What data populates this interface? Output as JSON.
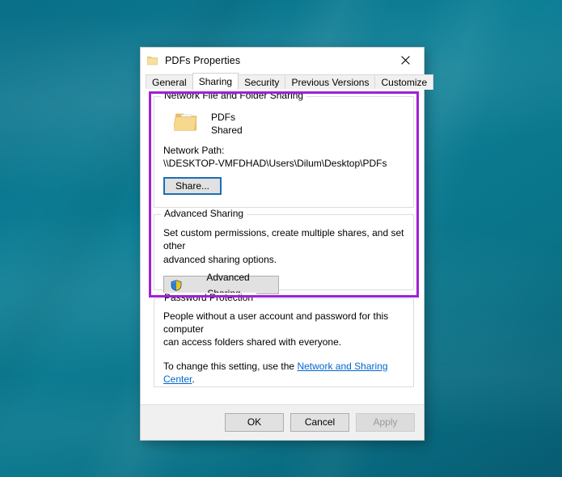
{
  "window": {
    "title": "PDFs Properties",
    "icon": "folder-icon",
    "close_label": "✕"
  },
  "tabs": [
    {
      "label": "General",
      "active": false
    },
    {
      "label": "Sharing",
      "active": true
    },
    {
      "label": "Security",
      "active": false
    },
    {
      "label": "Previous Versions",
      "active": false
    },
    {
      "label": "Customize",
      "active": false
    }
  ],
  "network_sharing": {
    "legend": "Network File and Folder Sharing",
    "folder_name": "PDFs",
    "share_status": "Shared",
    "network_path_label": "Network Path:",
    "network_path_value": "\\\\DESKTOP-VMFDHAD\\Users\\Dilum\\Desktop\\PDFs",
    "share_button": "Share..."
  },
  "advanced_sharing": {
    "legend": "Advanced Sharing",
    "description_line1": "Set custom permissions, create multiple shares, and set other",
    "description_line2": "advanced sharing options.",
    "button_label": "Advanced Sharing...",
    "button_icon": "uac-shield-icon"
  },
  "password_protection": {
    "legend": "Password Protection",
    "line1": "People without a user account and password for this computer",
    "line2": "can access folders shared with everyone.",
    "line3_prefix": "To change this setting, use the ",
    "link_text": "Network and Sharing Center",
    "line3_suffix": "."
  },
  "footer": {
    "ok": "OK",
    "cancel": "Cancel",
    "apply": "Apply"
  },
  "annotation": {
    "color": "#a020d8"
  }
}
